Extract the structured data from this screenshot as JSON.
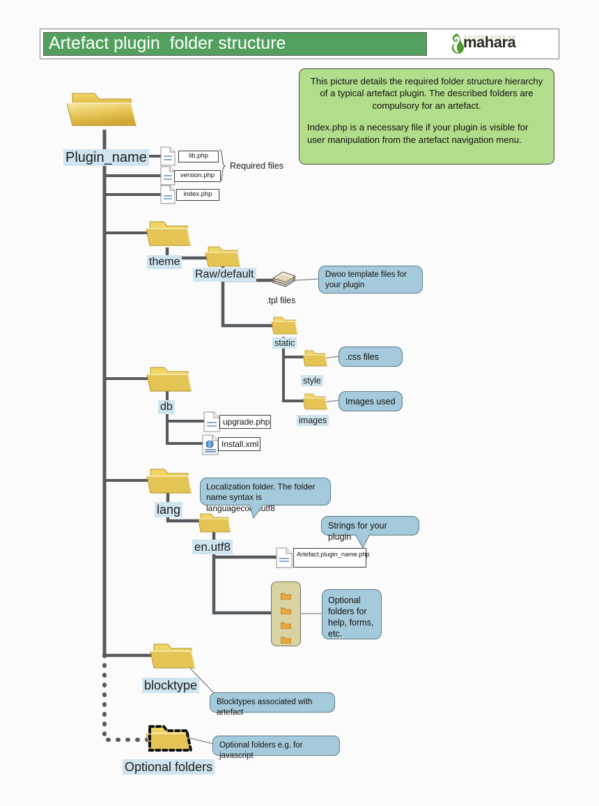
{
  "header": {
    "title": "Artefact plugin  folder structure",
    "logo_text": "mahara",
    "logo_icon": "mahara-koru-icon"
  },
  "info_box": {
    "paragraph_1": "This picture details the required folder structure hierarchy of a typical artefact plugin. The described folders are compulsory for an artefact.",
    "paragraph_2": "Index.php is a necessary file if your plugin is visible for user manipulation from the artefact navigation menu."
  },
  "tree": {
    "root_label": "Plugin_name",
    "required_files_label": "Required files",
    "files": [
      {
        "name": "lib.php"
      },
      {
        "name": "version.php"
      },
      {
        "name": "index.php"
      }
    ],
    "folders": {
      "theme": "theme",
      "raw_default": "Raw/default",
      "static": "static",
      "style": "style",
      "images": "images",
      "db": "db",
      "lang": "lang",
      "en_utf8": "en.utf8",
      "blocktype": "blocktype",
      "optional_folders": "Optional folders"
    },
    "tpl_files_label": ".tpl files",
    "db_files": [
      {
        "name": "upgrade.php"
      },
      {
        "name": "Install.xml"
      }
    ],
    "lang_file": "Artefact.plugin_name.php"
  },
  "callouts": {
    "dwoo": "Dwoo template files for your plugin",
    "css": ".css files",
    "images_used": "Images used",
    "localization_line1": "Localization folder. The folder",
    "localization_line2": "name syntax is languagecode.utf8",
    "strings": "Strings for your plugin",
    "optional_folders_for": "Optional folders for help, forms, etc.",
    "blocktypes": "Blocktypes associated with artefact",
    "optional_js": "Optional folders e.g. for javascript"
  },
  "colors": {
    "header_green": "#53a05e",
    "info_green": "#b2dd8a",
    "callout_blue": "#a4cadb",
    "label_highlight": "#cfe4ef",
    "folder_yellow": "#e7c44f",
    "line_gray": "#555a5e"
  }
}
